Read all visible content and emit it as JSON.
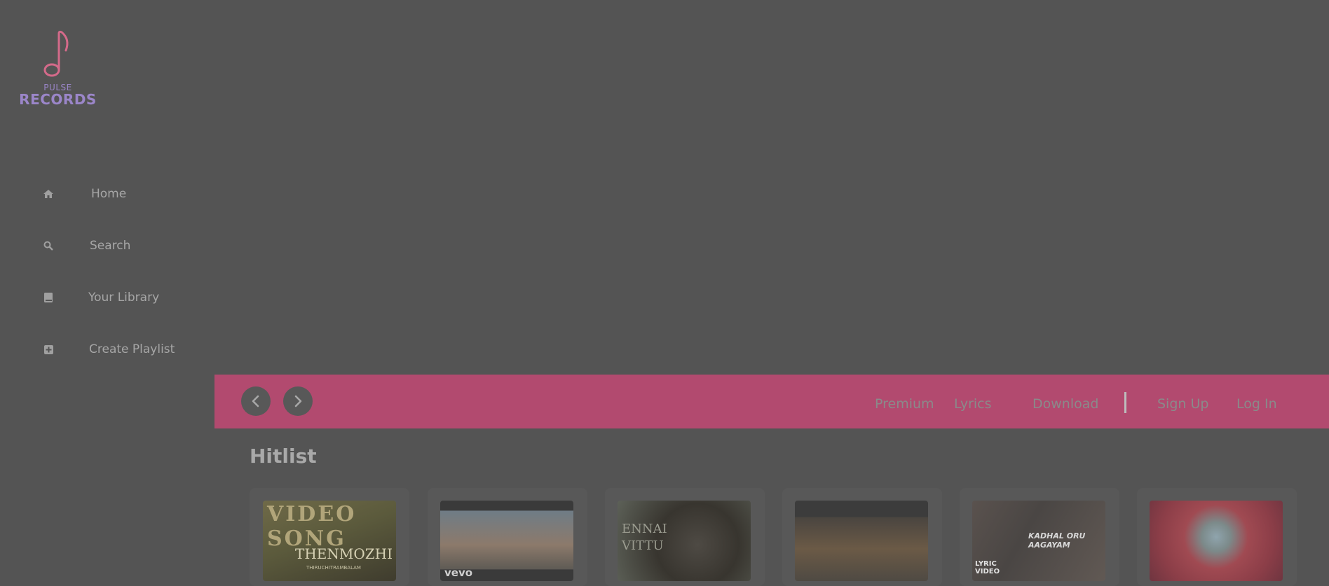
{
  "logo": {
    "small": "PULSE",
    "big": "RECORDS"
  },
  "sidebar": {
    "items": [
      {
        "label": "Home",
        "icon": "home-icon"
      },
      {
        "label": "Search",
        "icon": "search-icon"
      },
      {
        "label": "Your Library",
        "icon": "book-icon"
      },
      {
        "label": "Create Playlist",
        "icon": "plus-square-icon"
      }
    ]
  },
  "topbar": {
    "links": [
      "Premium",
      "Lyrics",
      "Download"
    ],
    "auth": [
      "Sign Up",
      "Log In"
    ],
    "accent": "#b24a6f"
  },
  "hitlist": {
    "title": "Hitlist",
    "cards": [
      {
        "overlay_top": "VIDEO SONG",
        "overlay_bottom": "THENMOZHI",
        "overlay_caption": "THIRUCHITRAMBALAM"
      },
      {
        "overlay_bottom": "vevo"
      },
      {
        "overlay_top": "ENNAI",
        "overlay_bottom": "VITTU"
      },
      {},
      {
        "overlay_top": "KADHAL ORU AAGAYAM",
        "overlay_bottom": "LYRIC VIDEO"
      },
      {}
    ]
  },
  "colors": {
    "background": "#545454",
    "brand_pink": "#d46a8a",
    "brand_purple": "#9b86c9"
  }
}
